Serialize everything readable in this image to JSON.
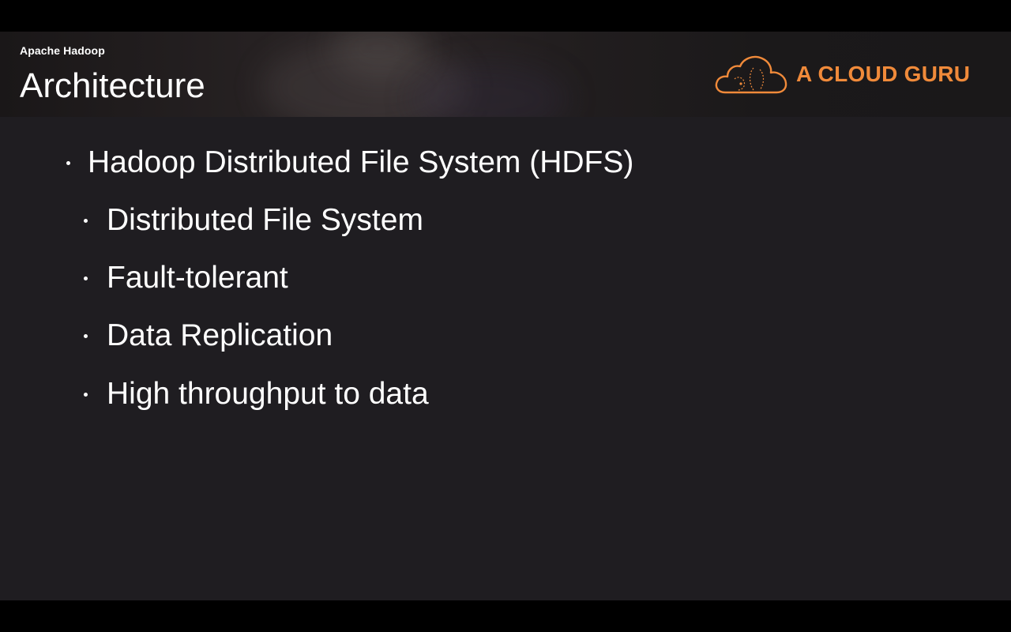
{
  "header": {
    "subtitle": "Apache Hadoop",
    "title": "Architecture"
  },
  "logo": {
    "text": "A CLOUD GURU",
    "icon": "cloud-icon",
    "color": "#f08a3a"
  },
  "bullets": {
    "main": "Hadoop Distributed File System (HDFS)",
    "sub": [
      "Distributed File System",
      "Fault-tolerant",
      "Data Replication",
      "High throughput to data"
    ]
  },
  "colors": {
    "background": "#1f1d21",
    "letterbox": "#000000",
    "text": "#ffffff",
    "accent": "#f08a3a"
  }
}
